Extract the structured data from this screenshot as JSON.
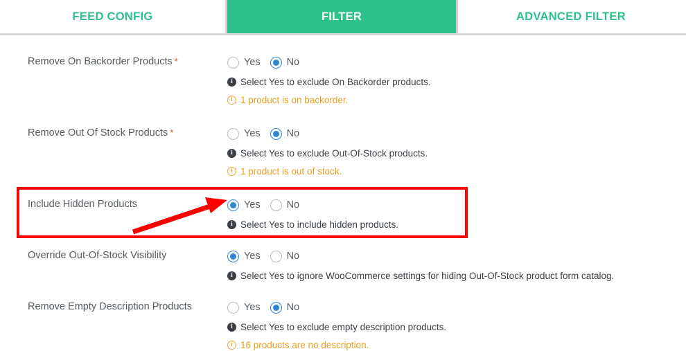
{
  "tabs": [
    {
      "id": "feed-config",
      "label": "FEED CONFIG",
      "active": false
    },
    {
      "id": "filter",
      "label": "FILTER",
      "active": true
    },
    {
      "id": "advanced-filter",
      "label": "ADVANCED FILTER",
      "active": false
    }
  ],
  "colors": {
    "tab_active_bg": "#2ec18b",
    "tab_inactive_text": "#2ec08a",
    "radio_selected": "#2e86d4",
    "required_asterisk": "#e8453c",
    "warning_text": "#e8a020",
    "annotation": "#fa0000"
  },
  "radio_options": {
    "yes": "Yes",
    "no": "No"
  },
  "rows": [
    {
      "id": "remove-on-backorder-products",
      "label": "Remove On Backorder Products",
      "required": true,
      "required_mark": "*",
      "selected": "No",
      "description": "Select Yes to exclude On Backorder products.",
      "warning": "1 product is on backorder."
    },
    {
      "id": "remove-out-of-stock-products",
      "label": "Remove Out Of Stock Products",
      "required": true,
      "required_mark": "*",
      "selected": "No",
      "description": "Select Yes to exclude Out-Of-Stock products.",
      "warning": "1 product is out of stock."
    },
    {
      "id": "include-hidden-products",
      "label": "Include Hidden Products",
      "required": false,
      "required_mark": "",
      "selected": "Yes",
      "description": "Select Yes to include hidden products.",
      "warning": ""
    },
    {
      "id": "override-out-of-stock-visibility",
      "label": "Override Out-Of-Stock Visibility",
      "required": false,
      "required_mark": "",
      "selected": "Yes",
      "description": "Select Yes to ignore WooCommerce settings for hiding Out-Of-Stock product form catalog.",
      "warning": ""
    },
    {
      "id": "remove-empty-description-products",
      "label": "Remove Empty Description Products",
      "required": false,
      "required_mark": "",
      "selected": "No",
      "description": "Select Yes to exclude empty description products.",
      "warning": "16 products are no description."
    }
  ],
  "annotation": {
    "highlight_target": "include-hidden-products",
    "arrow_points_to": "yes-radio"
  },
  "icons": {
    "info_dark": "info-circle-filled-icon",
    "info_warning": "info-circle-outline-icon"
  }
}
